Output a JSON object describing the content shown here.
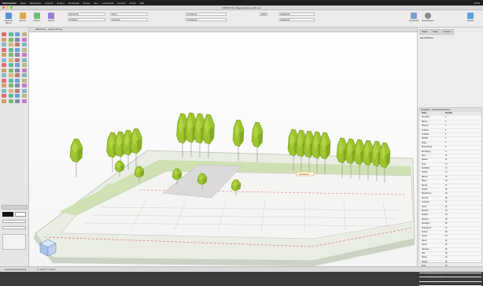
{
  "menubar": {
    "app": "Vectorworks",
    "items": [
      "Datei",
      "Bearbeiten",
      "Ansicht",
      "Ändern",
      "3D-Modell",
      "Extras",
      "Text",
      "Landschaft",
      "Fenster",
      "Cloud",
      "Hilfe"
    ],
    "clock": "11:52"
  },
  "window": {
    "title": "200226 Vitt_Wegneestrasse 149.vwx"
  },
  "toolbar": {
    "buttons": [
      {
        "label": "Konstruk. Ebene",
        "color": "#5a8fd6"
      },
      {
        "label": "Ebenen",
        "color": "#e8a34a"
      },
      {
        "label": "Klassen",
        "color": "#6cc07a"
      },
      {
        "label": "Ansicht",
        "color": "#9b7fd1"
      }
    ],
    "fields": {
      "view_mode": "3D Ansicht",
      "render_mode": "Schattiert",
      "class": "Keine",
      "layer": "Grundriss",
      "style": "Vorgabestil",
      "zoom": "100%"
    },
    "right_buttons": [
      {
        "label": "Arbeitsblatt",
        "color": "#7aa0c8"
      },
      {
        "label": "Einstellungen",
        "color": "#8a8a8a"
      },
      {
        "label": "Objekte",
        "color": "#5c9fd8"
      }
    ]
  },
  "view": {
    "tab": "200226 Vitt_...strasse 149.vwx",
    "command_bar": "Objekt-Anzeigen",
    "tag": "Gebaude"
  },
  "tools": {
    "colors": [
      "#d44",
      "#3a8",
      "#48c",
      "#aa6",
      "#c84",
      "#5a5",
      "#669",
      "#b5b",
      "#6ab",
      "#ca5",
      "#a55",
      "#5aa"
    ],
    "count": 56
  },
  "right_panel": {
    "tabs": [
      "Objekt",
      "Daten",
      "Rendern"
    ],
    "title": "Mehrfachfläche",
    "props_title": "Navigation - Konstruktionsebenen",
    "rows": [
      [
        "Name",
        "Sichtbar"
      ],
      [
        "Grundriss",
        "1"
      ],
      [
        "Bäume",
        "2"
      ],
      [
        "Pflanzen",
        "3"
      ],
      [
        "Gelände",
        "4"
      ],
      [
        "Gebäude",
        "5"
      ],
      [
        "Mobiliar",
        "6"
      ],
      [
        "Wege",
        "7"
      ],
      [
        "Beleuchtung",
        "8"
      ],
      [
        "Bemaßung",
        "9"
      ],
      [
        "Zaun",
        "10"
      ],
      [
        "Wasser",
        "11"
      ],
      [
        "Texte",
        "12"
      ],
      [
        "Stellplätze",
        "13"
      ],
      [
        "Hecken",
        "14"
      ],
      [
        "Mauern",
        "15"
      ],
      [
        "Rasen",
        "16"
      ],
      [
        "Schnitt",
        "17"
      ],
      [
        "Ansicht",
        "18"
      ],
      [
        "Planrahmen",
        "19"
      ],
      [
        "Grenzen",
        "20"
      ],
      [
        "Leitungen",
        "21"
      ],
      [
        "Kanal",
        "22"
      ],
      [
        "Bestand",
        "23"
      ],
      [
        "Neubau",
        "24"
      ],
      [
        "Abbruch",
        "25"
      ],
      [
        "Sonstiges",
        "26"
      ],
      [
        "Hintergrund",
        "27"
      ],
      [
        "Notizen",
        "28"
      ],
      [
        "Layout",
        "29"
      ],
      [
        "Export",
        "30"
      ],
      [
        "Import",
        "31"
      ],
      [
        "Varianten",
        "32"
      ],
      [
        "Plan",
        "33"
      ],
      [
        "Raster",
        "34"
      ],
      [
        "Modell",
        "35"
      ],
      [
        "Final",
        "36"
      ],
      [
        "Archiv",
        "37"
      ],
      [
        "Reserve",
        "38"
      ],
      [
        "Extra",
        "39"
      ],
      [
        "Ende",
        "40"
      ]
    ]
  },
  "status": {
    "left": "Auswahl durch Rechteck",
    "coords": "X: 12.45 m   Y: 8.32 m"
  }
}
